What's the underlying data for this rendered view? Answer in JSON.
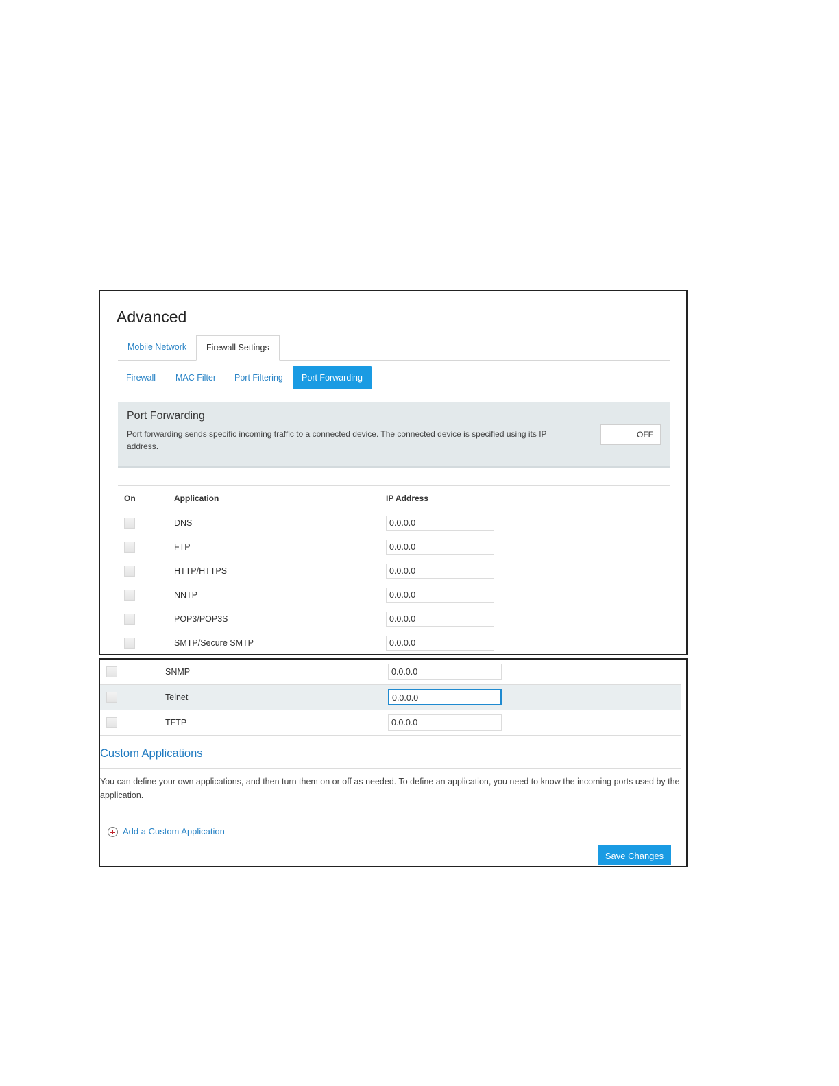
{
  "page_title": "Advanced",
  "tabs": [
    {
      "label": "Mobile Network",
      "active": false
    },
    {
      "label": "Firewall Settings",
      "active": true
    }
  ],
  "subtabs": [
    {
      "label": "Firewall",
      "active": false
    },
    {
      "label": "MAC Filter",
      "active": false
    },
    {
      "label": "Port Filtering",
      "active": false
    },
    {
      "label": "Port Forwarding",
      "active": true
    }
  ],
  "port_forwarding": {
    "title": "Port Forwarding",
    "description": "Port forwarding sends specific incoming traffic to a connected device. The connected device is specified using its IP address.",
    "toggle_state": "OFF"
  },
  "table": {
    "headers": {
      "on": "On",
      "application": "Application",
      "ip": "IP Address"
    },
    "rows": [
      {
        "app": "DNS",
        "ip": "0.0.0.0",
        "on": false
      },
      {
        "app": "FTP",
        "ip": "0.0.0.0",
        "on": false
      },
      {
        "app": "HTTP/HTTPS",
        "ip": "0.0.0.0",
        "on": false
      },
      {
        "app": "NNTP",
        "ip": "0.0.0.0",
        "on": false
      },
      {
        "app": "POP3/POP3S",
        "ip": "0.0.0.0",
        "on": false
      },
      {
        "app": "SMTP/Secure SMTP",
        "ip": "0.0.0.0",
        "on": false
      },
      {
        "app": "SNMP",
        "ip": "0.0.0.0",
        "on": false
      },
      {
        "app": "Telnet",
        "ip": "0.0.0.0",
        "on": false
      },
      {
        "app": "TFTP",
        "ip": "0.0.0.0",
        "on": false
      }
    ]
  },
  "custom": {
    "title": "Custom Applications",
    "description": "You can define your own applications, and then turn them on or off as needed. To define an application, you need to know the incoming ports used by the application.",
    "add_label": "Add a Custom Application"
  },
  "save_label": "Save Changes",
  "colors": {
    "accent": "#1a9be3",
    "link": "#2a84c6",
    "panel": "#e3e9eb"
  }
}
